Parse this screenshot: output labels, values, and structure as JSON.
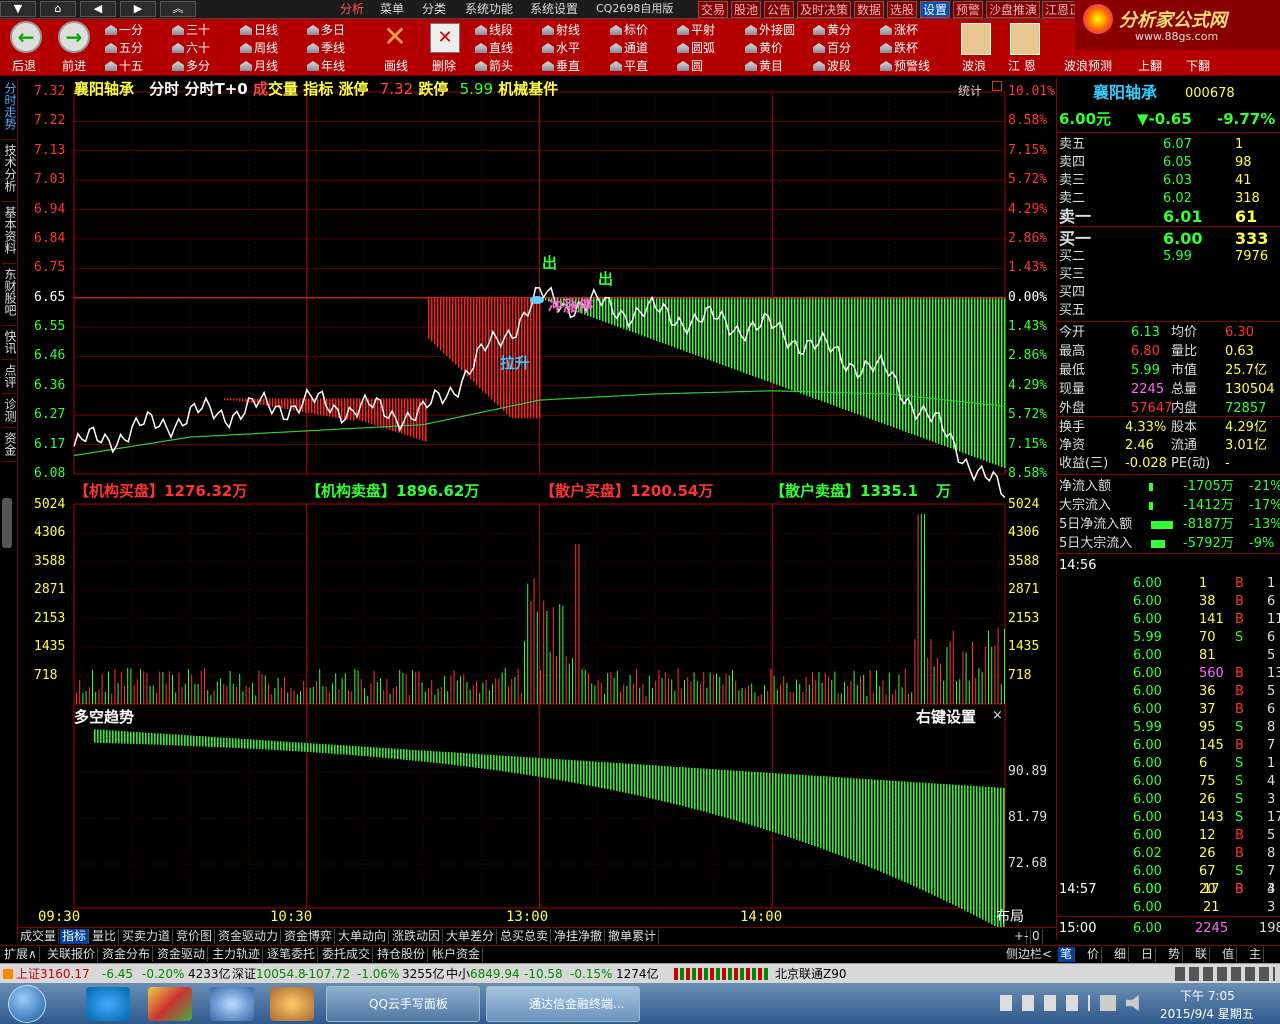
{
  "nav": {
    "back_glyph": "▲",
    "prev_glyph": "◀",
    "next_glyph": "▶",
    "up_glyph": "⏏"
  },
  "menu": {
    "items": [
      "分析",
      "菜单",
      "分类",
      "系统功能",
      "系统设置",
      "CQ2698自用版"
    ],
    "right_items": [
      "交易",
      "股池",
      "公告",
      "及时决策",
      "数据",
      "选股",
      "设置",
      "预警",
      "沙盘推演",
      "江恩正"
    ],
    "logo_text": "分析家公式网",
    "logo_url": "www.88gs.com"
  },
  "toolbar": {
    "back": "后退",
    "forward": "前进",
    "periods": [
      [
        "一分",
        "三十",
        "日线",
        "多日"
      ],
      [
        "五分",
        "六十",
        "周线",
        "季线"
      ],
      [
        "十五",
        "多分",
        "月线",
        "年线"
      ]
    ],
    "draw": "画线",
    "delete": "删除",
    "lines": [
      [
        "线段",
        "射线",
        "标价",
        "平射",
        "外接圆",
        "黄分",
        "涨杯"
      ],
      [
        "直线",
        "水平",
        "通道",
        "圆弧",
        "黄价",
        "百分",
        "跌杯"
      ],
      [
        "箭头",
        "垂直",
        "平直",
        "圆",
        "黄目",
        "波段",
        "预警线"
      ]
    ],
    "wave": "波浪",
    "gann": "江 恩",
    "wave_predict": "波浪预测",
    "page_up": "上翻",
    "page_down": "下翻"
  },
  "left_tabs": [
    "分时走势",
    "技术分析",
    "基本资料",
    "东财股吧",
    "快讯",
    "点评",
    "诊测",
    "资金"
  ],
  "chart_header": {
    "name": "襄阳轴承",
    "mode": "分时",
    "mode2": "分时T+0",
    "vol1": "成",
    "vol2": "交量",
    "ind": "指标",
    "limit_up_label": "涨停",
    "limit_up": "7.32",
    "limit_down_label": "跌停",
    "limit_down": "5.99",
    "sector": "机械基件",
    "stat": "统计"
  },
  "price_axis": [
    "7.32",
    "7.22",
    "7.13",
    "7.03",
    "6.94",
    "6.84",
    "6.75",
    "6.65",
    "6.55",
    "6.46",
    "6.36",
    "6.27",
    "6.17",
    "6.08"
  ],
  "pct_axis": [
    "10.01%",
    "8.58%",
    "7.15%",
    "5.72%",
    "4.29%",
    "2.86%",
    "1.43%",
    "0.00%",
    "1.43%",
    "2.86%",
    "4.29%",
    "5.72%",
    "7.15%",
    "8.58%"
  ],
  "vol_axis": [
    "5024",
    "4306",
    "3588",
    "2871",
    "2153",
    "1435",
    "718"
  ],
  "ind_axis": [
    "90.89",
    "81.79",
    "72.68"
  ],
  "time_axis": [
    "09:30",
    "10:30",
    "13:00",
    "14:00"
  ],
  "annotations": {
    "out1": "出",
    "out2": "出",
    "pull": "拉升",
    "limit_attempt": "冲涨停"
  },
  "order_flow": {
    "inst_buy_label": "【机构买盘】",
    "inst_buy": "1276.32万",
    "inst_sell_label": "【机构卖盘】",
    "inst_sell": "1896.62万",
    "retail_buy_label": "【散户买盘】",
    "retail_buy": "1200.54万",
    "retail_sell_label": "【散户卖盘】",
    "retail_sell": "1335.1",
    "retail_sell_tail": "万"
  },
  "indicator": {
    "title": "多空趋势",
    "settings": "右键设置",
    "close": "×"
  },
  "chart_data": {
    "type": "line",
    "title": "襄阳轴承 分时",
    "prev_close": 6.65,
    "ylim": [
      6.08,
      7.32
    ],
    "x": [
      "09:30",
      "10:00",
      "10:30",
      "11:00",
      "11:30/13:00",
      "13:30",
      "14:00",
      "14:30",
      "15:00"
    ],
    "series": [
      {
        "name": "price",
        "values": [
          6.17,
          6.27,
          6.31,
          6.27,
          6.65,
          6.6,
          6.55,
          6.4,
          6.0
        ]
      },
      {
        "name": "avg",
        "values": [
          6.14,
          6.2,
          6.22,
          6.24,
          6.32,
          6.34,
          6.35,
          6.34,
          6.3
        ]
      }
    ]
  },
  "quote": {
    "name": "襄阳轴承",
    "code": "000678",
    "price": "6.00元",
    "change": "▼-0.65",
    "change_pct": "-9.77%",
    "asks": [
      [
        "卖五",
        "6.07",
        "1"
      ],
      [
        "卖四",
        "6.05",
        "98"
      ],
      [
        "卖三",
        "6.03",
        "41"
      ],
      [
        "卖二",
        "6.02",
        "318"
      ],
      [
        "卖一",
        "6.01",
        "61"
      ]
    ],
    "bids": [
      [
        "买一",
        "6.00",
        "333"
      ],
      [
        "买二",
        "5.99",
        "7976"
      ],
      [
        "买三",
        "",
        ""
      ],
      [
        "买四",
        "",
        ""
      ],
      [
        "买五",
        "",
        ""
      ]
    ],
    "stats": [
      [
        "今开",
        "6.13",
        "均价",
        "6.30"
      ],
      [
        "最高",
        "6.80",
        "量比",
        "0.63"
      ],
      [
        "最低",
        "5.99",
        "市值",
        "25.7亿"
      ],
      [
        "现量",
        "2245",
        "总量",
        "130504"
      ],
      [
        "外盘",
        "57647",
        "内盘",
        "72857"
      ]
    ],
    "stats2": [
      [
        "换手",
        "4.33%",
        "股本",
        "4.29亿"
      ],
      [
        "净资",
        "2.46",
        "流通",
        "3.01亿"
      ],
      [
        "收益(三)",
        "-0.028",
        "PE(动)",
        "-"
      ]
    ],
    "flows": [
      [
        "净流入额",
        "-1705万",
        "-21%"
      ],
      [
        "大宗流入",
        "-1412万",
        "-17%"
      ],
      [
        "5日净流入额",
        "-8187万",
        "-13%"
      ],
      [
        "5日大宗流入",
        "-5792万",
        "-9%"
      ]
    ],
    "ticks_time1": "14:56",
    "ticks": [
      [
        "6.00",
        "1",
        "B",
        "1"
      ],
      [
        "6.00",
        "38",
        "B",
        "6"
      ],
      [
        "6.00",
        "141",
        "B",
        "11"
      ],
      [
        "5.99",
        "70",
        "S",
        "6"
      ],
      [
        "6.00",
        "81",
        "",
        "5"
      ],
      [
        "6.00",
        "560",
        "B",
        "13"
      ],
      [
        "6.00",
        "36",
        "B",
        "5"
      ],
      [
        "6.00",
        "37",
        "B",
        "6"
      ],
      [
        "5.99",
        "95",
        "S",
        "8"
      ],
      [
        "6.00",
        "145",
        "B",
        "7"
      ],
      [
        "6.00",
        "6",
        "S",
        "1"
      ],
      [
        "6.00",
        "75",
        "S",
        "4"
      ],
      [
        "6.00",
        "26",
        "S",
        "3"
      ],
      [
        "6.00",
        "143",
        "S",
        "17"
      ],
      [
        "6.00",
        "12",
        "B",
        "5"
      ],
      [
        "6.02",
        "26",
        "B",
        "8"
      ],
      [
        "6.00",
        "67",
        "S",
        "7"
      ],
      [
        "6.00",
        "20",
        "B",
        "3"
      ]
    ],
    "ticks_time2": "14:57",
    "ticks2": [
      [
        "6.00",
        "17",
        "B",
        "4"
      ],
      [
        "6.00",
        "21",
        "",
        "3"
      ]
    ],
    "ticks_time3": "15:00",
    "close_tick": [
      "6.00",
      "2245",
      "198"
    ]
  },
  "bottom_tabs": [
    "成交量",
    "指标",
    "量比",
    "买卖力道",
    "竞价图",
    "资金驱动力",
    "资金博弈",
    "大单动向",
    "涨跌动因",
    "大单差分",
    "总买总卖",
    "净挂净撤",
    "撤单累计"
  ],
  "bottom_tabs_nav": [
    "布局",
    "+",
    "-",
    "0"
  ],
  "bottom_tabs2": [
    "扩展∧",
    "关联报价",
    "资金分布",
    "资金驱动",
    "主力轨迹",
    "逐笔委托",
    "委托成交",
    "持仓股份",
    "帐户资金"
  ],
  "side_label": "侧边栏<",
  "right_tabs": [
    "笔",
    "价",
    "细",
    "日",
    "势",
    "联",
    "值",
    "主"
  ],
  "status": {
    "sh_label": "上证",
    "sh": "3160.17",
    "sh_chg": "-6.45",
    "sh_pct": "-0.20%",
    "sh_amt": "4233亿",
    "sz_label": "深证",
    "sz": "10054.8",
    "sz_chg": "-107.72",
    "sz_pct": "-1.06%",
    "sz_amt": "3255亿",
    "zx_label": "中小",
    "zx": "6849.94",
    "zx_chg": "-10.58",
    "zx_pct": "-0.15%",
    "zx_amt": "1274亿",
    "conn": "北京联通Z90"
  },
  "taskbar": {
    "app1": "QQ云手写面板",
    "app2": "通达信金融终端...",
    "time": "下午 7:05",
    "date": "2015/9/4 星期五"
  },
  "colors": {
    "up": "#ff3333",
    "down": "#33ff33",
    "price_line": "#ffffff",
    "avg_line": "#33cc33",
    "grid": "#8b0000",
    "label_yellow": "#ffff44"
  }
}
